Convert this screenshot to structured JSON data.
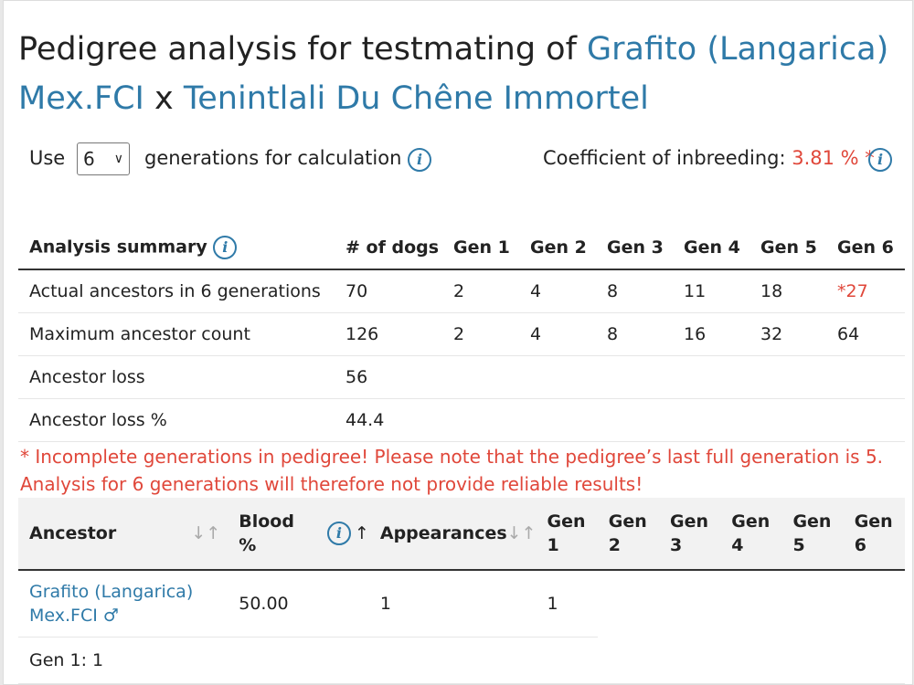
{
  "title": {
    "prefix": "Pedigree analysis for testmating of ",
    "sire": "Grafito (Langarica) Mex.FCI",
    "separator": " x ",
    "dam": "Tenintlali Du Chêne Immortel"
  },
  "controls": {
    "use_label": "Use",
    "generations_value": "6",
    "generations_suffix": "generations for calculation",
    "coi_label": "Coefficient of inbreeding:",
    "coi_value": "3.81 % *",
    "info_glyph": "i"
  },
  "summary": {
    "header": [
      "Analysis summary",
      "# of dogs",
      "Gen 1",
      "Gen 2",
      "Gen 3",
      "Gen 4",
      "Gen 5",
      "Gen 6"
    ],
    "rows": [
      [
        "Actual ancestors in 6 generations",
        "70",
        "2",
        "4",
        "8",
        "11",
        "18",
        "*27"
      ],
      [
        "Maximum ancestor count",
        "126",
        "2",
        "4",
        "8",
        "16",
        "32",
        "64"
      ],
      [
        "Ancestor loss",
        "56",
        "",
        "",
        "",
        "",
        "",
        ""
      ],
      [
        "Ancestor loss %",
        "44.4",
        "",
        "",
        "",
        "",
        "",
        ""
      ]
    ]
  },
  "notice": "* Incomplete generations in pedigree! Please note that the pedigree’s last full generation is 5. Analysis for 6 generations will therefore not provide reliable results!",
  "ancestors": {
    "headers": {
      "ancestor": "Ancestor",
      "blood_line1": "Blood",
      "blood_line2": "%",
      "appearances": "Appearances",
      "gen1_a": "Gen",
      "gen1_b": "1",
      "gen2_a": "Gen",
      "gen2_b": "2",
      "gen3_a": "Gen",
      "gen3_b": "3",
      "gen4_a": "Gen",
      "gen4_b": "4",
      "gen5_a": "Gen",
      "gen5_b": "5",
      "gen6_a": "Gen",
      "gen6_b": "6"
    },
    "sort_icons": {
      "inactive": "↓↑",
      "active": "↑"
    },
    "rows": [
      {
        "name_line1": "Grafito (Langarica)",
        "name_line2": "Mex.FCI",
        "sex_symbol": "♂",
        "blood": "50.00",
        "appearances": "1",
        "gen1": "1"
      }
    ],
    "group_label": "Gen 1: 1"
  },
  "colors": {
    "link": "#2f7aa8",
    "warning": "#e0473a"
  }
}
